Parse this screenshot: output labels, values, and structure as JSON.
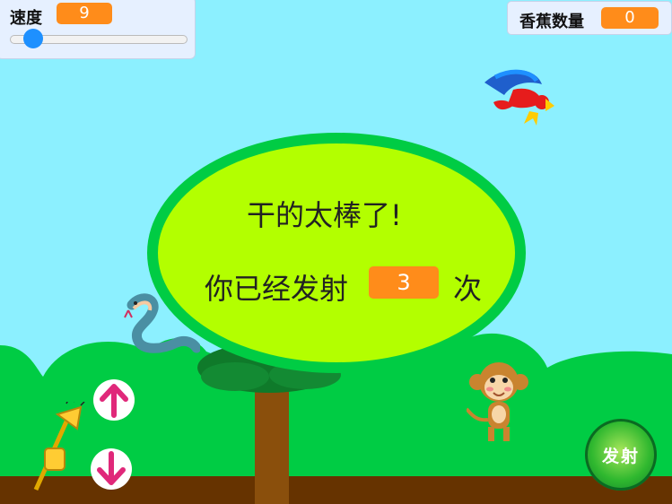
{
  "speed_monitor": {
    "label": "速度",
    "value": "9",
    "slider_level": 0.1
  },
  "banana_monitor": {
    "label": "香蕉数量",
    "value": "0"
  },
  "message": {
    "title": "干的太棒了!",
    "prefix": "你已经发射",
    "count": "3",
    "suffix": "次"
  },
  "controls": {
    "fire_label": "发射",
    "up_icon": "arrow-up-icon",
    "down_icon": "arrow-down-icon"
  },
  "colors": {
    "sky": "#8cf0ff",
    "bush": "#00cc44",
    "ground": "#663300",
    "bubble": "#b3ff00",
    "bubble_border": "#00cc44",
    "value_bg": "#ff8c1a",
    "arrow": "#e0287a"
  }
}
